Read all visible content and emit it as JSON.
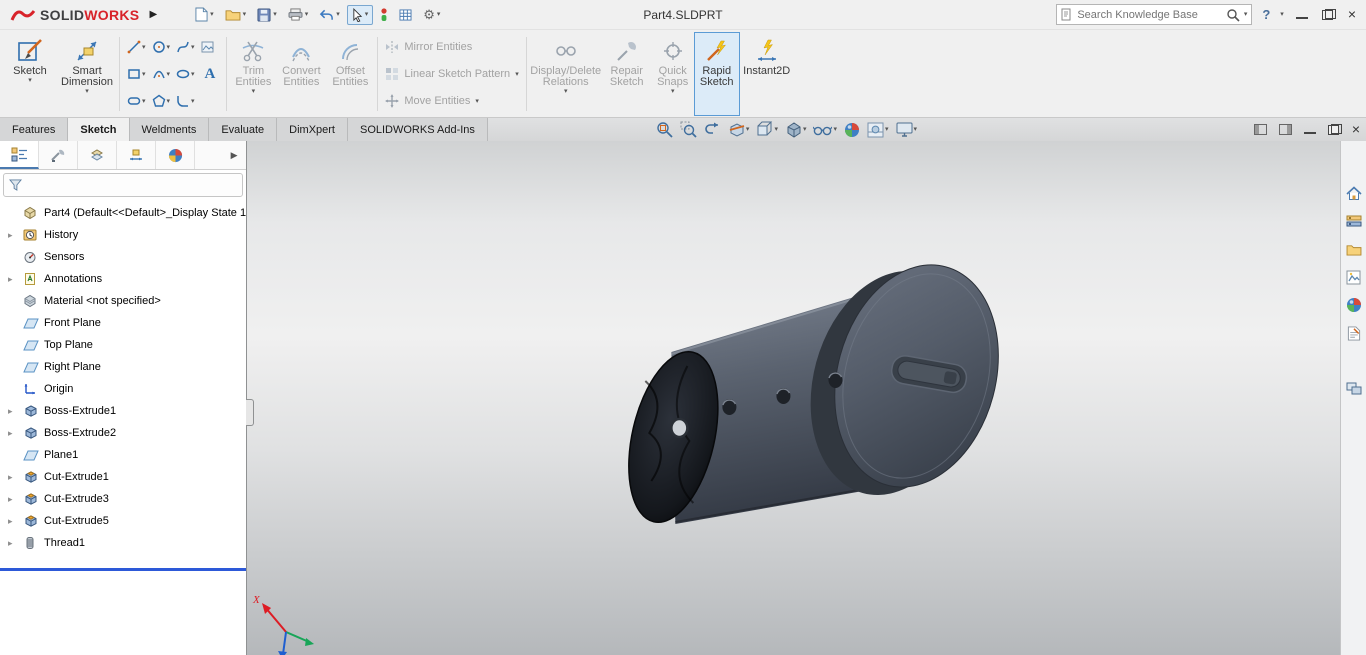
{
  "titlebar": {
    "logo_solid": "SOLID",
    "logo_works": "WORKS",
    "document_title": "Part4.SLDPRT",
    "search_placeholder": "Search Knowledge Base",
    "help_label": "?"
  },
  "ribbon": {
    "sketch": {
      "label": "Sketch"
    },
    "smart_dimension": {
      "label": "Smart Dimension"
    },
    "trim": {
      "label": "Trim Entities"
    },
    "convert": {
      "label": "Convert Entities"
    },
    "offset": {
      "label": "Offset Entities"
    },
    "mirror": {
      "label": "Mirror Entities"
    },
    "linear_pattern": {
      "label": "Linear Sketch Pattern"
    },
    "move": {
      "label": "Move Entities"
    },
    "display_delete": {
      "label": "Display/Delete Relations"
    },
    "repair": {
      "label": "Repair Sketch"
    },
    "quick_snaps": {
      "label": "Quick Snaps"
    },
    "rapid_sketch": {
      "label": "Rapid Sketch"
    },
    "instant2d": {
      "label": "Instant2D"
    }
  },
  "command_tabs": [
    {
      "label": "Features",
      "active": false
    },
    {
      "label": "Sketch",
      "active": true
    },
    {
      "label": "Weldments",
      "active": false
    },
    {
      "label": "Evaluate",
      "active": false
    },
    {
      "label": "DimXpert",
      "active": false
    },
    {
      "label": "SOLIDWORKS Add-Ins",
      "active": false
    }
  ],
  "feature_tree": {
    "root_label": "Part4 (Default<<Default>_Display State 1",
    "items": [
      {
        "label": "History",
        "icon": "history",
        "expandable": true
      },
      {
        "label": "Sensors",
        "icon": "sensors",
        "expandable": false
      },
      {
        "label": "Annotations",
        "icon": "annotations",
        "expandable": true
      },
      {
        "label": "Material <not specified>",
        "icon": "material",
        "expandable": false
      },
      {
        "label": "Front Plane",
        "icon": "plane",
        "expandable": false
      },
      {
        "label": "Top Plane",
        "icon": "plane",
        "expandable": false
      },
      {
        "label": "Right Plane",
        "icon": "plane",
        "expandable": false
      },
      {
        "label": "Origin",
        "icon": "origin",
        "expandable": false
      },
      {
        "label": "Boss-Extrude1",
        "icon": "boss-extrude",
        "expandable": true
      },
      {
        "label": "Boss-Extrude2",
        "icon": "boss-extrude",
        "expandable": true
      },
      {
        "label": "Plane1",
        "icon": "plane",
        "expandable": false
      },
      {
        "label": "Cut-Extrude1",
        "icon": "cut-extrude",
        "expandable": true
      },
      {
        "label": "Cut-Extrude3",
        "icon": "cut-extrude",
        "expandable": true
      },
      {
        "label": "Cut-Extrude5",
        "icon": "cut-extrude",
        "expandable": true
      },
      {
        "label": "Thread1",
        "icon": "thread",
        "expandable": true
      }
    ]
  },
  "hud_toolbar": [
    "zoom-fit",
    "zoom-area",
    "previous-view",
    "section-view",
    "view-orientation",
    "display-style",
    "hide-show-items",
    "edit-appearance",
    "apply-scene",
    "view-settings"
  ],
  "quick_access": [
    "new-document",
    "open-document",
    "save",
    "print",
    "undo",
    "select",
    "status-indicator",
    "options-table",
    "options-gear"
  ],
  "taskpane": [
    "home",
    "design-library",
    "file-explorer",
    "view-palette",
    "appearances",
    "custom-properties",
    "monitors"
  ],
  "triad": {
    "x_label": "X"
  },
  "colors": {
    "accent_blue": "#5b9bd5",
    "rollback_blue": "#2d59d8",
    "part_gray": "#565e6a",
    "logo_red": "#d8232a"
  }
}
